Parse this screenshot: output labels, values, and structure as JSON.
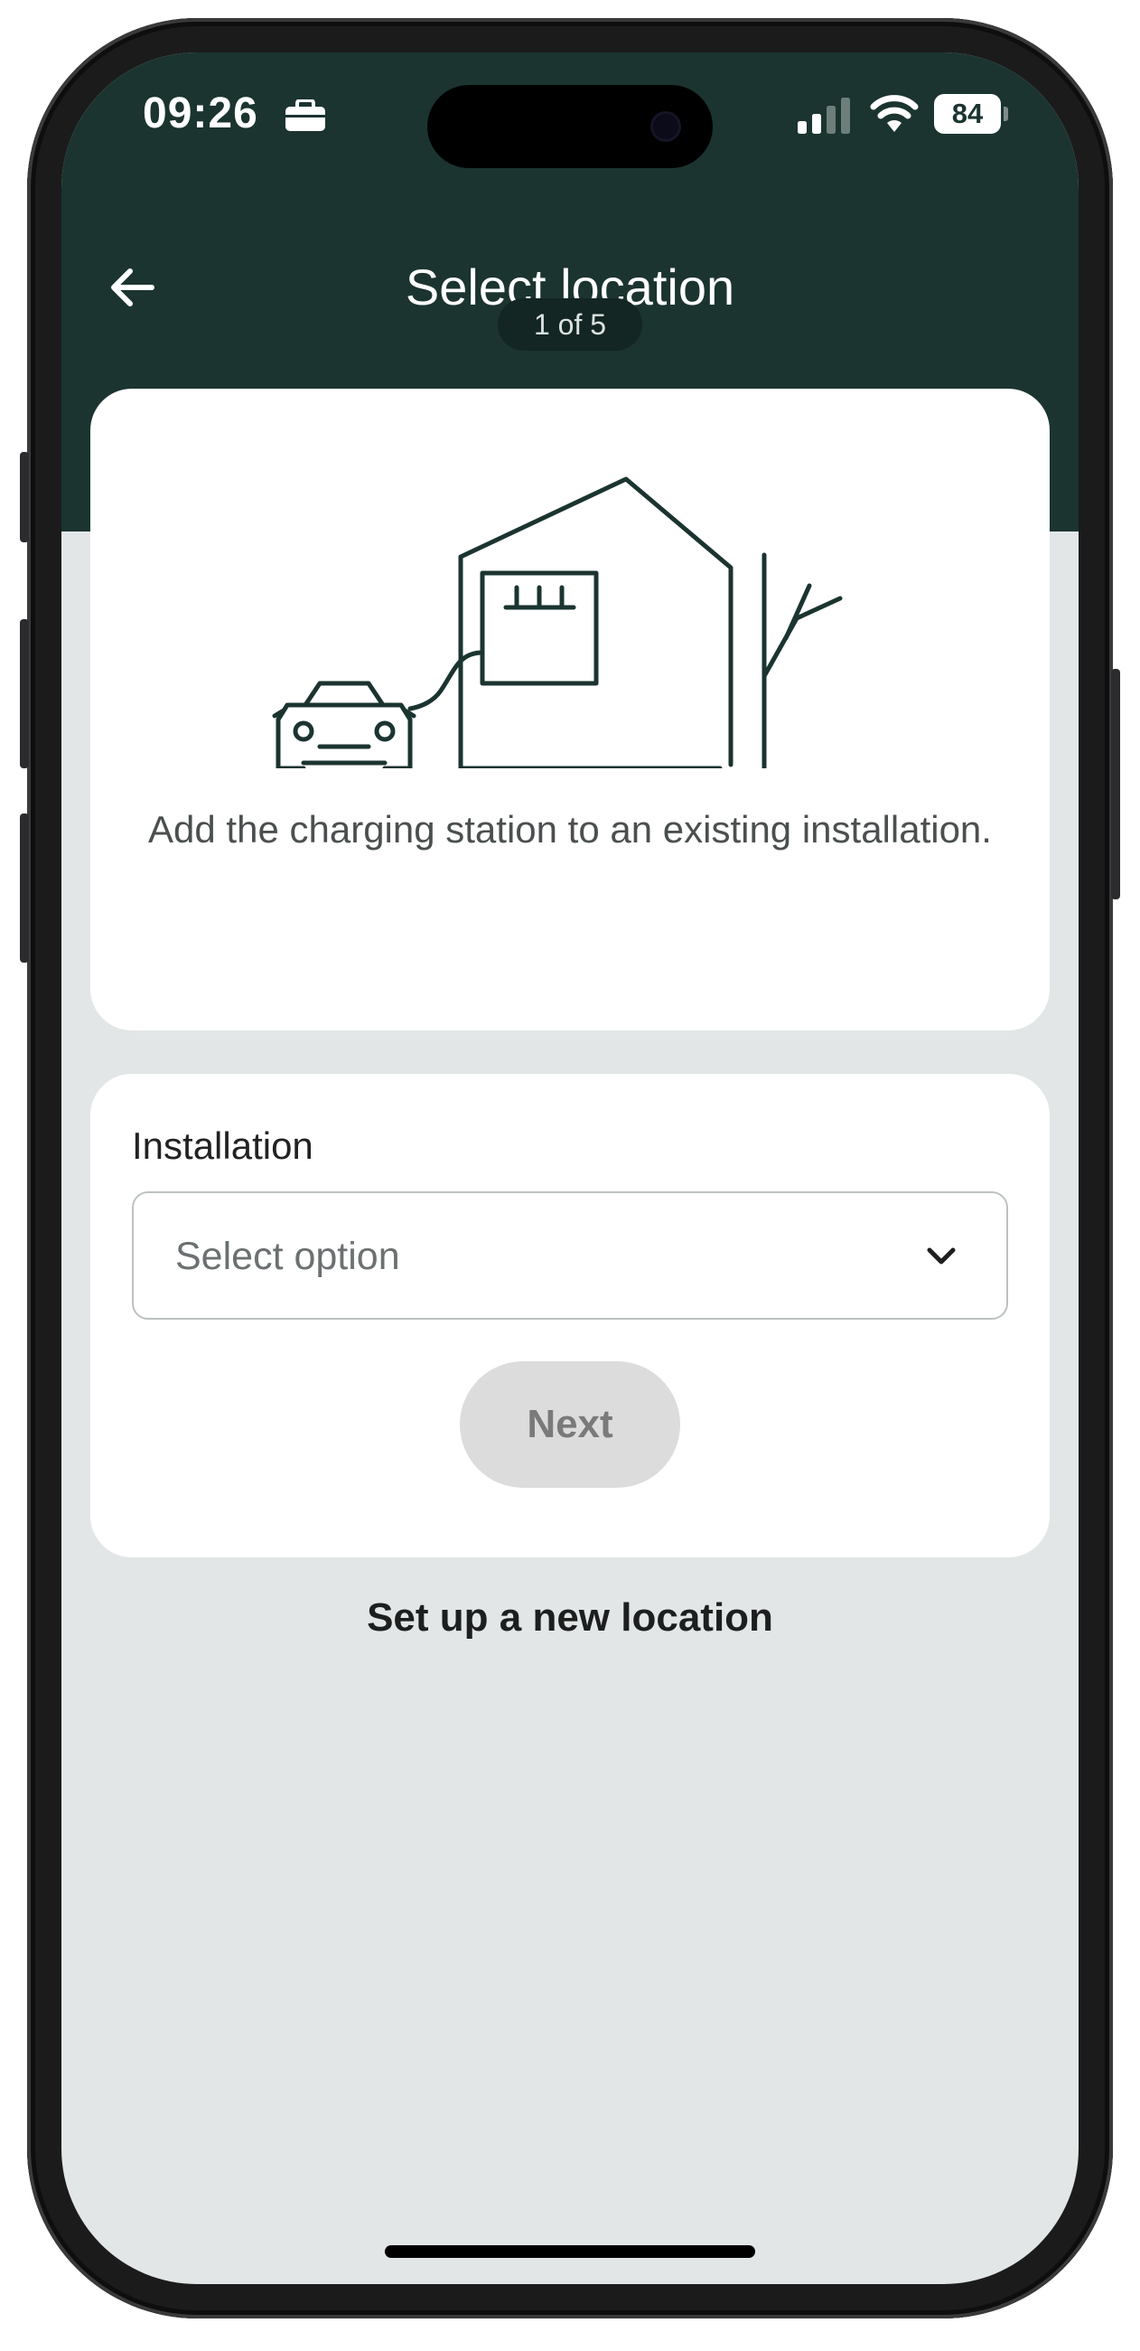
{
  "status_bar": {
    "time": "09:26",
    "battery_level": "84",
    "icons": [
      "briefcase-icon",
      "signal-icon",
      "wifi-icon",
      "battery-icon"
    ]
  },
  "header": {
    "title": "Select location",
    "step_indicator": "1 of 5",
    "back_icon": "arrow-left-icon"
  },
  "illustration": {
    "icon": "car-house-charger-illustration",
    "caption": "Add the charging station to an existing installation."
  },
  "form": {
    "installation_label": "Installation",
    "installation_placeholder": "Select option",
    "next_label": "Next",
    "next_disabled": true
  },
  "links": {
    "new_location": "Set up a new location"
  },
  "colors": {
    "header_bg": "#1b3430",
    "screen_bg": "#e2e6e7",
    "card_bg": "#ffffff",
    "illustration_stroke": "#1b3430",
    "disabled_button_bg": "#dcdcdc",
    "disabled_button_text": "#7a7a7a"
  }
}
